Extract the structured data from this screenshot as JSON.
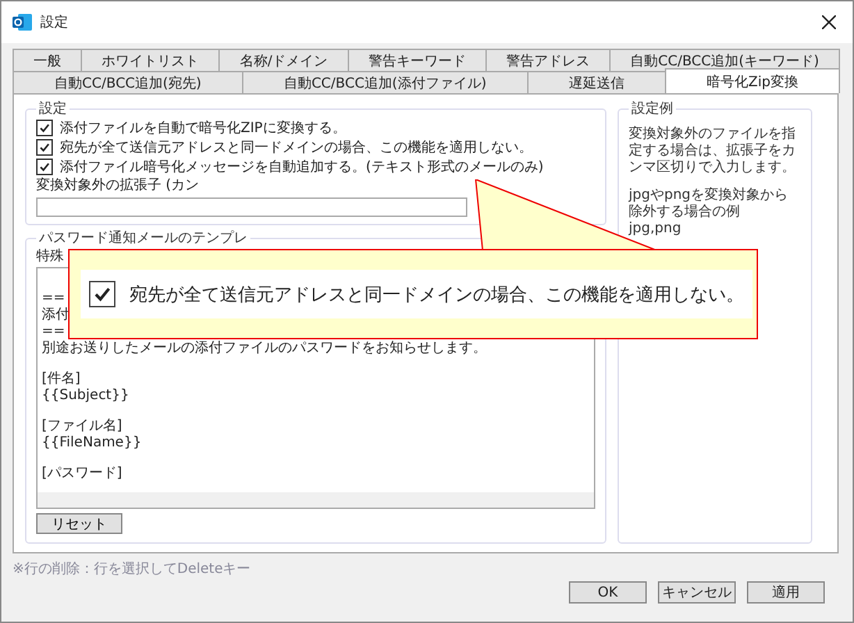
{
  "window": {
    "title": "設定"
  },
  "tabs_row_1": [
    {
      "label": "一般",
      "selected": false
    },
    {
      "label": "ホワイトリスト",
      "selected": false
    },
    {
      "label": "名称/ドメイン",
      "selected": false
    },
    {
      "label": "警告キーワード",
      "selected": false
    },
    {
      "label": "警告アドレス",
      "selected": false
    },
    {
      "label": "自動CC/BCC追加(キーワード)",
      "selected": false
    }
  ],
  "tabs_row_2": [
    {
      "label": "自動CC/BCC追加(宛先)",
      "selected": false
    },
    {
      "label": "自動CC/BCC追加(添付ファイル)",
      "selected": false
    },
    {
      "label": "遅延送信",
      "selected": false
    },
    {
      "label": "暗号化Zip変換",
      "selected": true
    }
  ],
  "settings_group": {
    "title": "設定",
    "checkboxes": [
      {
        "label": "添付ファイルを自動で暗号化ZIPに変換する。",
        "checked": true
      },
      {
        "label": "宛先が全て送信元アドレスと同一ドメインの場合、この機能を適用しない。",
        "checked": true
      },
      {
        "label": "添付ファイル暗号化メッセージを自動追加する。(テキスト形式のメールのみ)",
        "checked": true
      }
    ],
    "extension_label": "変換対象外の拡張子 (カン"
  },
  "template_group": {
    "title": "パスワード通知メールのテンプレ",
    "label": "特殊",
    "paragraphs": [
      [
        "==",
        "添付",
        "==",
        "別途お送りしたメールの添付ファイルのパスワードをお知らせします。"
      ],
      [
        "[件名]",
        "{{Subject}}"
      ],
      [
        "[ファイル名]",
        "{{FileName}}"
      ],
      [
        "[パスワード]"
      ]
    ],
    "reset_button": "リセット"
  },
  "example_group": {
    "title": "設定例",
    "paragraphs": [
      "変換対象外のファイルを指定する場合は、拡張子をカンマ区切りで入力します。",
      "jpgやpngを変換対象から除外する場合の例\njpg,png"
    ]
  },
  "callout": {
    "label": "宛先が全て送信元アドレスと同一ドメインの場合、この機能を適用しない。",
    "checked": true
  },
  "hint": "※行の削除：行を選択してDeleteキー",
  "buttons": [
    "OK",
    "キャンセル",
    "適用"
  ]
}
